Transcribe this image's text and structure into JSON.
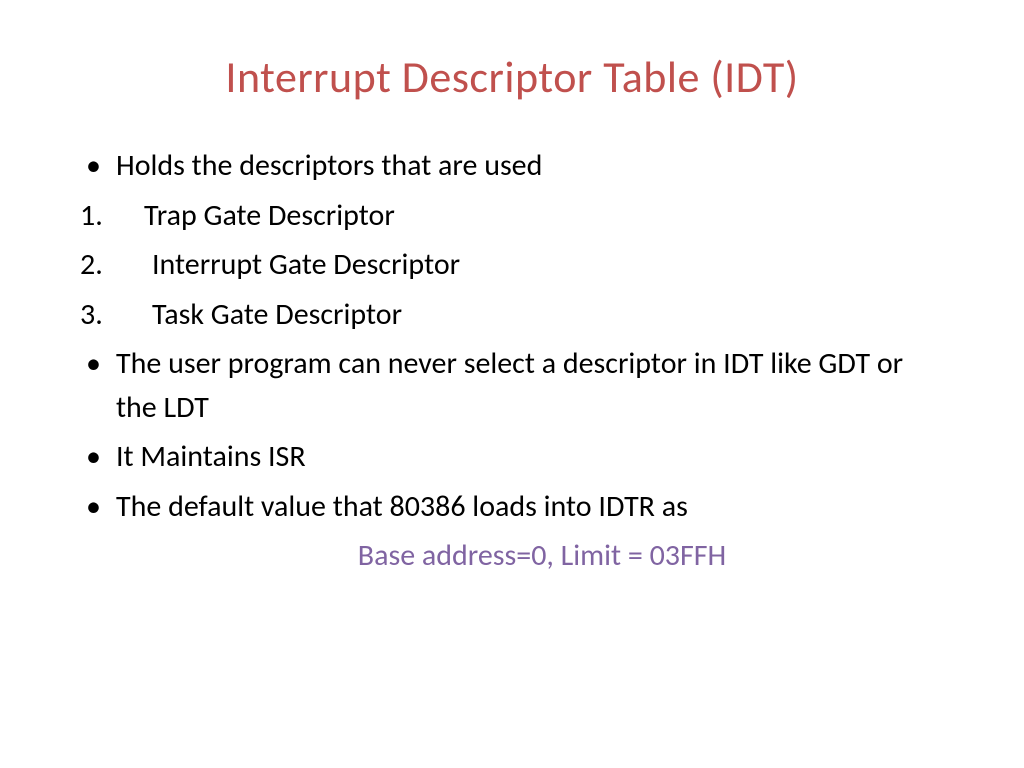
{
  "slide": {
    "title": "Interrupt Descriptor Table (IDT)",
    "bullets": {
      "b1": "Holds the descriptors that are used",
      "n1_num": "1.",
      "n1_text": "Trap Gate Descriptor",
      "n2_num": "2.",
      "n2_text": "Interrupt Gate Descriptor",
      "n3_num": "3.",
      "n3_text": "Task  Gate Descriptor",
      "b2": "The user program can never select a descriptor in IDT like GDT or the LDT",
      "b3": "It Maintains ISR",
      "b4": "The default value that 80386 loads into IDTR as"
    },
    "footer": "Base address=0, Limit = 03FFH"
  }
}
